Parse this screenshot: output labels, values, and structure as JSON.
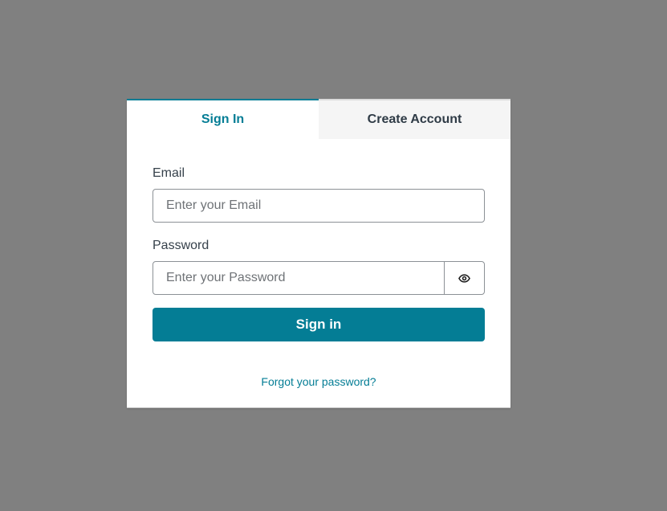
{
  "tabs": {
    "sign_in": "Sign In",
    "create_account": "Create Account"
  },
  "form": {
    "email_label": "Email",
    "email_placeholder": "Enter your Email",
    "password_label": "Password",
    "password_placeholder": "Enter your Password",
    "show_password_icon": "eye-icon",
    "submit_label": "Sign in",
    "forgot_label": "Forgot your password?"
  },
  "colors": {
    "accent": "#047d95",
    "backdrop": "#808080",
    "card": "#ffffff",
    "inactive_tab": "#f5f5f5"
  }
}
